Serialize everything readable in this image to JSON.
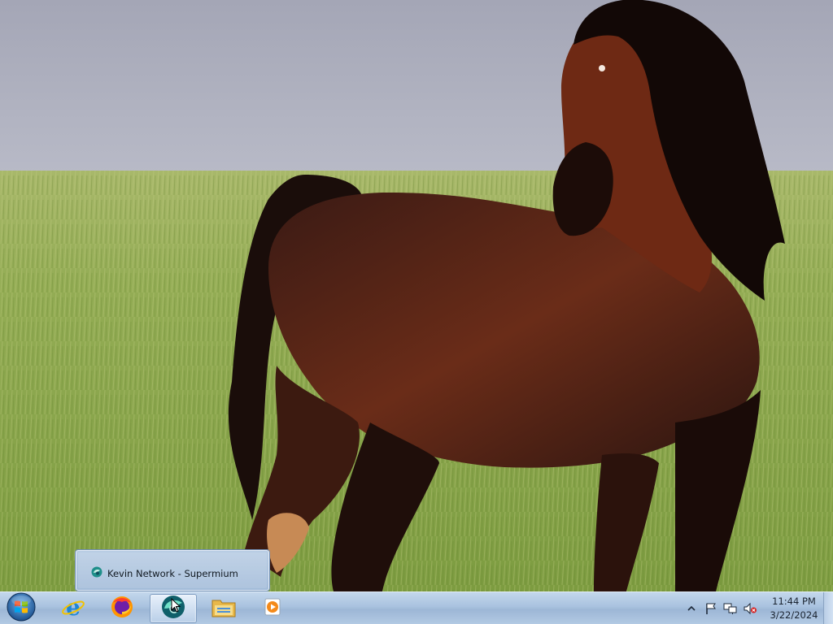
{
  "desktop": {
    "wallpaper": "horse-in-grassland"
  },
  "taskbar": {
    "start_icon": "windows-logo-icon",
    "pinned": [
      {
        "name": "internet-explorer",
        "icon": "ie-icon"
      },
      {
        "name": "firefox",
        "icon": "firefox-icon"
      },
      {
        "name": "supermium",
        "icon": "supermium-icon",
        "active": true
      },
      {
        "name": "file-explorer",
        "icon": "folder-icon"
      },
      {
        "name": "media-player",
        "icon": "media-player-icon"
      }
    ],
    "tray": {
      "icons": [
        "chevron-up-icon",
        "action-center-flag-icon",
        "network-icon",
        "volume-muted-icon"
      ],
      "time": "11:44 PM",
      "date": "3/22/2024"
    }
  },
  "thumbnail_popup": {
    "title": "Kevin Network - Supermium",
    "icon": "supermium-icon"
  },
  "colors": {
    "taskbar": "#a9c2df",
    "sky": "#a8a9b8",
    "grass": "#9ab35a",
    "horse": "#6b2a16"
  }
}
